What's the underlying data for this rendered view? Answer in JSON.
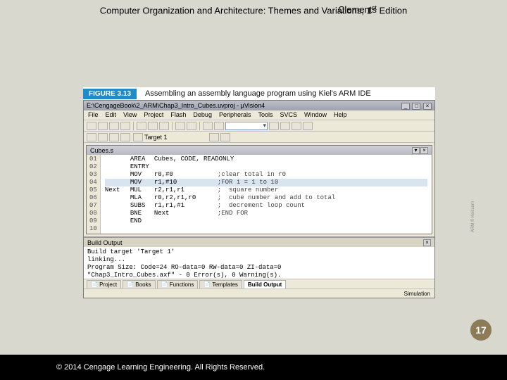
{
  "slide": {
    "header_prefix": "Computer Organization and Architecture: Themes and Variations, 1",
    "header_sup": "st",
    "header_suffix": " Edition",
    "author": "Clements",
    "page_number": "17",
    "copyright": "© 2014 Cengage Learning Engineering. All Rights Reserved."
  },
  "figure": {
    "tag": "FIGURE 3.13",
    "caption": "Assembling an assembly language program using Kiel's ARM IDE"
  },
  "ide": {
    "title": "E:\\CengageBook\\2_ARM\\Chap3_Intro_Cubes.uvproj - µVision4",
    "menu": [
      "File",
      "Edit",
      "View",
      "Project",
      "Flash",
      "Debug",
      "Peripherals",
      "Tools",
      "SVCS",
      "Window",
      "Help"
    ],
    "target_combo": "Target 1",
    "inner_title": "Cubes.s",
    "code_lines": [
      {
        "n": "01",
        "label": "",
        "op": "AREA",
        "args": "Cubes, CODE, READONLY",
        "c": ""
      },
      {
        "n": "02",
        "label": "",
        "op": "ENTRY",
        "args": "",
        "c": ""
      },
      {
        "n": "03",
        "label": "",
        "op": "MOV",
        "args": "r0,#0",
        "c": ";clear total in r0"
      },
      {
        "n": "04",
        "label": "",
        "op": "MOV",
        "args": "r1,#10",
        "c": ";FOR i = 1 to 10"
      },
      {
        "n": "05",
        "label": "Next",
        "op": "MUL",
        "args": "r2,r1,r1",
        "c": ";  square number"
      },
      {
        "n": "06",
        "label": "",
        "op": "MLA",
        "args": "r0,r2,r1,r0",
        "c": ";  cube number and add to total"
      },
      {
        "n": "07",
        "label": "",
        "op": "SUBS",
        "args": "r1,r1,#1",
        "c": ";  decrement loop count"
      },
      {
        "n": "08",
        "label": "",
        "op": "BNE",
        "args": "Next",
        "c": ";END FOR"
      },
      {
        "n": "09",
        "label": "",
        "op": "END",
        "args": "",
        "c": ""
      },
      {
        "n": "10",
        "label": "",
        "op": "",
        "args": "",
        "c": ""
      }
    ],
    "highlight_index": 3,
    "build": {
      "title": "Build Output",
      "lines": [
        "Build target 'Target 1'",
        "linking...",
        "Program Size: Code=24 RO-data=0 RW-data=0 ZI-data=0",
        "\"Chap3_Intro_Cubes.axf\" - 0 Error(s), 0 Warning(s)."
      ]
    },
    "tabs": [
      "Project",
      "Books",
      "Functions",
      "Templates",
      "Build Output"
    ],
    "active_tab_index": 4,
    "statusbar_right": "Simulation",
    "credit": "ARM © Keil.com"
  }
}
